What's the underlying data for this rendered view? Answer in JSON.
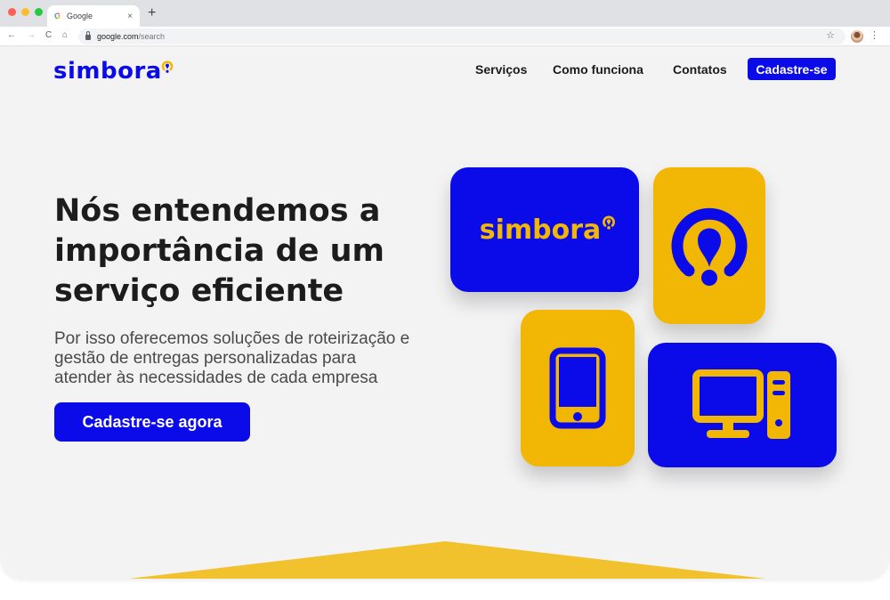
{
  "browser": {
    "tab_title": "Google",
    "tab_close": "×",
    "new_tab": "+",
    "url_host": "google.com",
    "url_path": "/search",
    "back": "←",
    "forward": "→",
    "reload": "C",
    "home": "⌂",
    "star": "☆",
    "menu": "⋮"
  },
  "site": {
    "logo_text": "simbora",
    "nav": {
      "services": "Serviços",
      "how_it_works": "Como funciona",
      "contacts": "Contatos",
      "signup": "Cadastre-se"
    },
    "hero": {
      "title_line1": "Nós entendemos a",
      "title_line2": "importância de um",
      "title_line3": "serviço eficiente",
      "subtitle_line1": "Por isso oferecemos soluções de roteirização e",
      "subtitle_line2": "gestão de entregas personalizadas para",
      "subtitle_line3": "atender às necessidades de cada empresa",
      "cta": "Cadastre-se agora"
    },
    "cards": {
      "logo_card_text": "simbora"
    }
  },
  "colors": {
    "brand_blue": "#0b0bea",
    "brand_yellow": "#f2b705",
    "page_bg": "#f3f3f4"
  },
  "icons": [
    "map-pin-icon",
    "smartphone-icon",
    "desktop-computer-icon",
    "lock-icon",
    "star-icon",
    "profile-avatar"
  ]
}
